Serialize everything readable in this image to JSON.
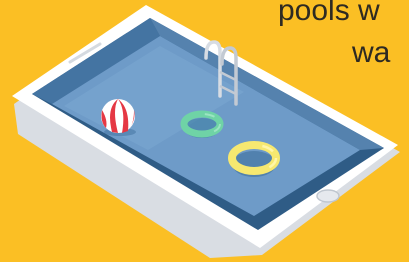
{
  "headline": {
    "line1": "pools w",
    "line2": "wa"
  },
  "illustration": {
    "icons": [
      "smartphone-icon",
      "swimming-pool-icon",
      "pool-ladder-icon",
      "beach-ball-icon",
      "swim-ring-icon"
    ]
  },
  "colors": {
    "background": "#FBBF24",
    "phone_body": "#FFFFFF",
    "phone_shadow": "#D9DDE3",
    "pool_water": "#6E9BC8",
    "pool_deep": "#3A6B99",
    "ring_green": "#6FD3A6",
    "ring_yellow": "#F6E870",
    "ball_red": "#E53844",
    "text": "#2E2A22"
  }
}
